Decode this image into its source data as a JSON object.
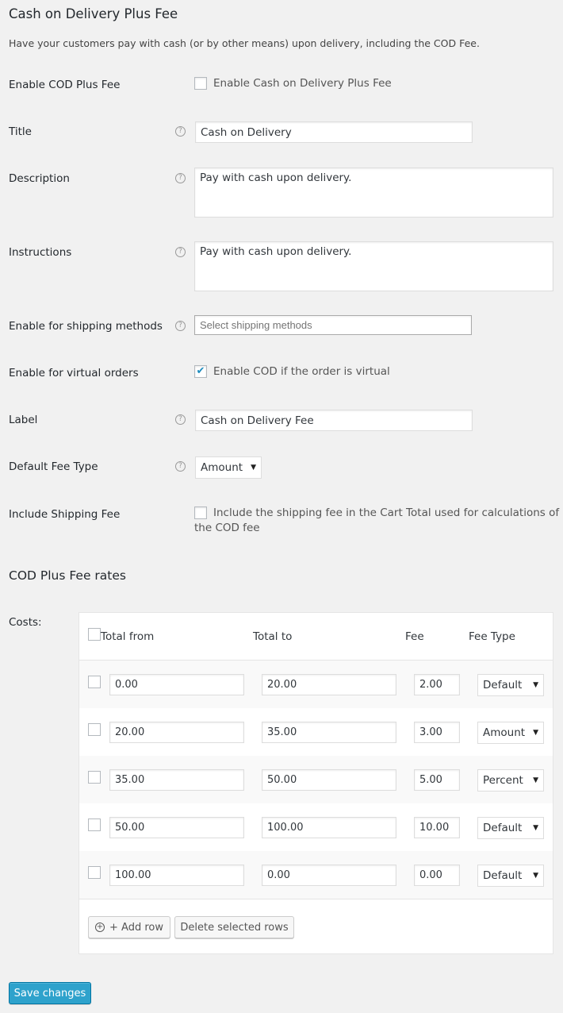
{
  "page": {
    "title": "Cash on Delivery Plus Fee",
    "description": "Have your customers pay with cash (or by other means) upon delivery, including the COD Fee."
  },
  "fields": {
    "enable": {
      "label": "Enable COD Plus Fee",
      "checkbox_label": "Enable Cash on Delivery Plus Fee",
      "checked": false
    },
    "title": {
      "label": "Title",
      "value": "Cash on Delivery"
    },
    "description": {
      "label": "Description",
      "value": "Pay with cash upon delivery."
    },
    "instructions": {
      "label": "Instructions",
      "value": "Pay with cash upon delivery."
    },
    "shipping_methods": {
      "label": "Enable for shipping methods",
      "placeholder": "Select shipping methods"
    },
    "virtual": {
      "label": "Enable for virtual orders",
      "checkbox_label": "Enable COD if the order is virtual",
      "checked": true
    },
    "fee_label": {
      "label": "Label",
      "value": "Cash on Delivery Fee"
    },
    "default_fee_type": {
      "label": "Default Fee Type",
      "value": "Amount"
    },
    "include_shipping": {
      "label": "Include Shipping Fee",
      "checkbox_label_line1": "Include the shipping fee in the Cart Total used for calculations of",
      "checkbox_label_line2": "the COD fee",
      "checked": false
    }
  },
  "rates": {
    "heading": "COD Plus Fee rates",
    "costs_label": "Costs:",
    "columns": [
      "Total from",
      "Total to",
      "Fee",
      "Fee Type"
    ],
    "rows": [
      {
        "from": "0.00",
        "to": "20.00",
        "fee": "2.00",
        "type": "Default"
      },
      {
        "from": "20.00",
        "to": "35.00",
        "fee": "3.00",
        "type": "Amount"
      },
      {
        "from": "35.00",
        "to": "50.00",
        "fee": "5.00",
        "type": "Percent"
      },
      {
        "from": "50.00",
        "to": "100.00",
        "fee": "10.00",
        "type": "Default"
      },
      {
        "from": "100.00",
        "to": "0.00",
        "fee": "0.00",
        "type": "Default"
      }
    ],
    "add_row": "+ Add row",
    "delete_rows": "Delete selected rows"
  },
  "save_label": "Save changes",
  "colors": {
    "primary": "#2ea2cc",
    "checkmark": "#1e8cbe"
  }
}
